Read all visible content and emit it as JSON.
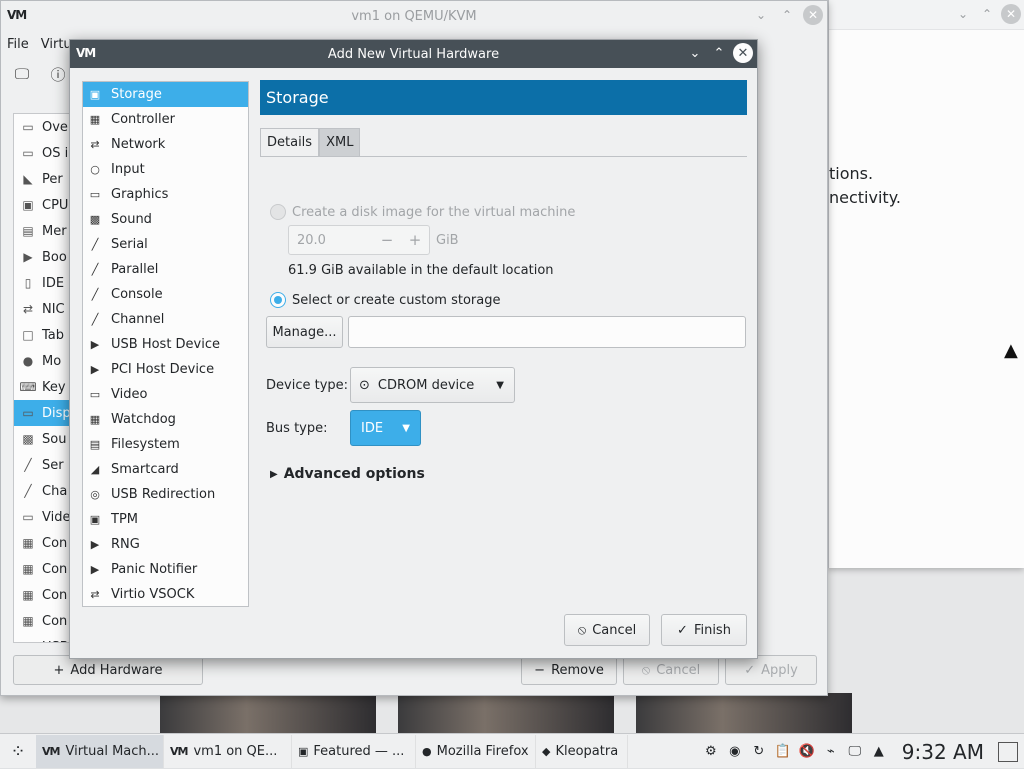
{
  "background_window": {
    "title": "vm1 on QEMU/KVM",
    "menu": [
      "File",
      "Virtu"
    ],
    "details_items": [
      {
        "label": "Ove",
        "icon": "monitor-icon"
      },
      {
        "label": "OS i",
        "icon": "monitor-icon"
      },
      {
        "label": "Per",
        "icon": "chart-icon"
      },
      {
        "label": "CPU",
        "icon": "chip-icon"
      },
      {
        "label": "Mer",
        "icon": "memory-icon"
      },
      {
        "label": "Boo",
        "icon": "boot-icon"
      },
      {
        "label": "IDE",
        "icon": "disk-icon"
      },
      {
        "label": "NIC",
        "icon": "network-icon"
      },
      {
        "label": "Tab",
        "icon": "tablet-icon"
      },
      {
        "label": "Mo",
        "icon": "mouse-icon"
      },
      {
        "label": "Key",
        "icon": "keyboard-icon"
      },
      {
        "label": "Disp",
        "icon": "display-icon"
      },
      {
        "label": "Sou",
        "icon": "sound-icon"
      },
      {
        "label": "Ser",
        "icon": "serial-icon"
      },
      {
        "label": "Cha",
        "icon": "channel-icon"
      },
      {
        "label": "Vide",
        "icon": "video-icon"
      },
      {
        "label": "Con",
        "icon": "controller-icon"
      },
      {
        "label": "Con",
        "icon": "controller-icon"
      },
      {
        "label": "Con",
        "icon": "controller-icon"
      },
      {
        "label": "Con",
        "icon": "controller-icon"
      },
      {
        "label": "USB",
        "icon": "usb-icon"
      }
    ],
    "add_hardware_label": "Add Hardware",
    "remove_label": "Remove",
    "cancel_label": "Cancel",
    "apply_label": "Apply"
  },
  "right_window": {
    "line1": "tions.",
    "line2": "nectivity."
  },
  "dialog": {
    "title": "Add New Virtual Hardware",
    "hardware_list": [
      {
        "label": "Storage",
        "icon": "storage-icon",
        "selected": true
      },
      {
        "label": "Controller",
        "icon": "controller-icon"
      },
      {
        "label": "Network",
        "icon": "network-icon"
      },
      {
        "label": "Input",
        "icon": "input-icon"
      },
      {
        "label": "Graphics",
        "icon": "graphics-icon"
      },
      {
        "label": "Sound",
        "icon": "sound-icon"
      },
      {
        "label": "Serial",
        "icon": "serial-icon"
      },
      {
        "label": "Parallel",
        "icon": "parallel-icon"
      },
      {
        "label": "Console",
        "icon": "console-icon"
      },
      {
        "label": "Channel",
        "icon": "channel-icon"
      },
      {
        "label": "USB Host Device",
        "icon": "usb-host-icon"
      },
      {
        "label": "PCI Host Device",
        "icon": "pci-host-icon"
      },
      {
        "label": "Video",
        "icon": "video-icon"
      },
      {
        "label": "Watchdog",
        "icon": "watchdog-icon"
      },
      {
        "label": "Filesystem",
        "icon": "filesystem-icon"
      },
      {
        "label": "Smartcard",
        "icon": "smartcard-icon"
      },
      {
        "label": "USB Redirection",
        "icon": "usb-redirection-icon"
      },
      {
        "label": "TPM",
        "icon": "tpm-icon"
      },
      {
        "label": "RNG",
        "icon": "rng-icon"
      },
      {
        "label": "Panic Notifier",
        "icon": "panic-notifier-icon"
      },
      {
        "label": "Virtio VSOCK",
        "icon": "vsock-icon"
      }
    ],
    "section_title": "Storage",
    "tabs": {
      "details": "Details",
      "xml": "XML"
    },
    "create_disk_label": "Create a disk image for the virtual machine",
    "disk_size_value": "20.0",
    "disk_size_unit": "GiB",
    "available_text": "61.9 GiB available in the default location",
    "select_custom_label": "Select or create custom storage",
    "manage_label": "Manage...",
    "storage_path_value": "",
    "device_type_label": "Device type:",
    "device_type_value": "CDROM device",
    "bus_type_label": "Bus type:",
    "bus_type_value": "IDE",
    "advanced_label": "Advanced options",
    "cancel_label": "Cancel",
    "finish_label": "Finish"
  },
  "taskbar": {
    "tasks": [
      {
        "label": "Virtual Mach...",
        "icon": "vm-manager-icon"
      },
      {
        "label": "vm1 on QE...",
        "icon": "vm-manager-icon"
      },
      {
        "label": "Featured — ...",
        "icon": "discover-icon"
      },
      {
        "label": "Mozilla Firefox",
        "icon": "firefox-icon"
      },
      {
        "label": "Kleopatra",
        "icon": "kleopatra-icon"
      }
    ],
    "clock": "9:32 AM"
  },
  "colors": {
    "accent": "#3daee9",
    "section_header": "#0c6fa8",
    "dialog_titlebar": "#475057"
  }
}
